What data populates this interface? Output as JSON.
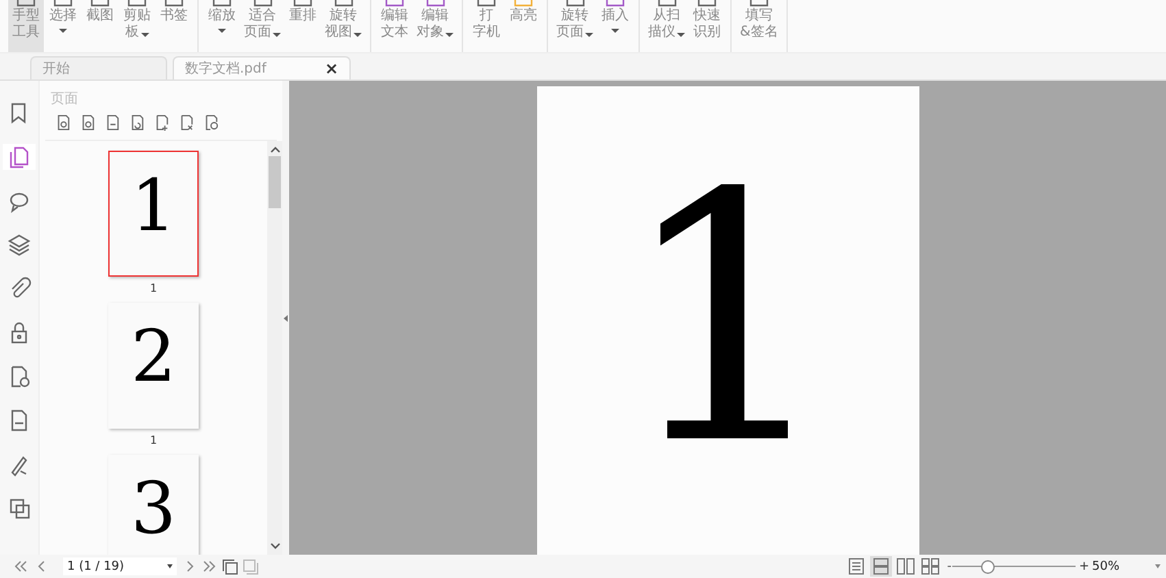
{
  "toolbar": {
    "groups": [
      [
        {
          "lines": [
            "手型",
            "工具"
          ],
          "dropdown": false,
          "selected": true
        },
        {
          "lines": [
            "选择"
          ],
          "dropdown": true,
          "selected": false
        },
        {
          "lines": [
            "截图"
          ],
          "dropdown": false,
          "selected": false
        },
        {
          "lines": [
            "剪贴",
            "板"
          ],
          "dropdown": true,
          "selected": false
        },
        {
          "lines": [
            "书签"
          ],
          "dropdown": false,
          "selected": false
        }
      ],
      [
        {
          "lines": [
            "缩放"
          ],
          "dropdown": true,
          "selected": false
        },
        {
          "lines": [
            "适合",
            "页面"
          ],
          "dropdown": true,
          "selected": false
        },
        {
          "lines": [
            "重排"
          ],
          "dropdown": false,
          "selected": false
        },
        {
          "lines": [
            "旋转",
            "视图"
          ],
          "dropdown": true,
          "selected": false
        }
      ],
      [
        {
          "lines": [
            "编辑",
            "文本"
          ],
          "dropdown": false,
          "selected": false
        },
        {
          "lines": [
            "编辑",
            "对象"
          ],
          "dropdown": true,
          "selected": false
        }
      ],
      [
        {
          "lines": [
            "打",
            "字机"
          ],
          "dropdown": false,
          "selected": false
        },
        {
          "lines": [
            "高亮"
          ],
          "dropdown": false,
          "selected": false
        }
      ],
      [
        {
          "lines": [
            "旋转",
            "页面"
          ],
          "dropdown": true,
          "selected": false
        },
        {
          "lines": [
            "插入"
          ],
          "dropdown": true,
          "selected": false
        }
      ],
      [
        {
          "lines": [
            "从扫",
            "描仪"
          ],
          "dropdown": true,
          "selected": false
        },
        {
          "lines": [
            "快速",
            "识别"
          ],
          "dropdown": false,
          "selected": false
        }
      ],
      [
        {
          "lines": [
            "填写",
            "&签名"
          ],
          "dropdown": false,
          "selected": false
        }
      ]
    ]
  },
  "tabs": [
    {
      "label": "开始",
      "selected": false
    },
    {
      "label": "数字文档.pdf",
      "selected": true,
      "close": "×"
    }
  ],
  "rail": [
    {
      "selected": false
    },
    {
      "selected": true
    },
    {
      "selected": false
    },
    {
      "selected": false
    },
    {
      "selected": false
    },
    {
      "selected": false
    },
    {
      "selected": false
    },
    {
      "selected": false
    },
    {
      "selected": false
    },
    {
      "selected": false
    }
  ],
  "pages_panel": {
    "title": "页面",
    "thumbnails": [
      {
        "number": "1",
        "label": "1",
        "selected": true
      },
      {
        "number": "2",
        "label": "1",
        "selected": false
      },
      {
        "number": "3",
        "selected": false
      }
    ]
  },
  "document": {
    "page_number": "1"
  },
  "status_bar": {
    "page_field": "1 (1 / 19)",
    "view_modes": [
      {
        "selected": false
      },
      {
        "selected": true
      },
      {
        "selected": false
      },
      {
        "selected": false
      }
    ],
    "zoom": {
      "level": 0.28,
      "minus": "-",
      "plus": "+",
      "value": "50%"
    }
  }
}
